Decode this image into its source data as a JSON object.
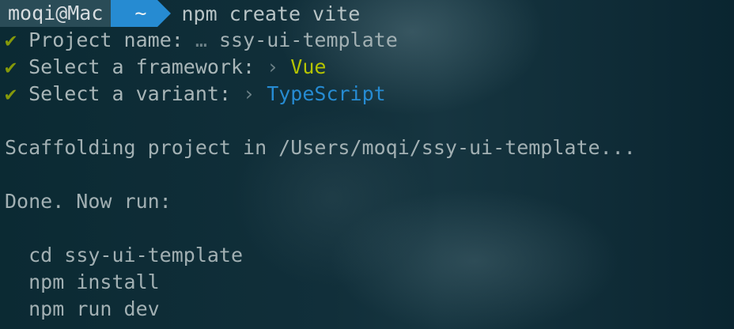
{
  "prompt": {
    "user_host": "moqi@Mac",
    "directory": "~",
    "command": "npm create vite"
  },
  "answers": [
    {
      "check": "✔",
      "label": "Project name:",
      "separator": "…",
      "value": "ssy-ui-template"
    },
    {
      "check": "✔",
      "label": "Select a framework:",
      "separator": "›",
      "value": "Vue"
    },
    {
      "check": "✔",
      "label": "Select a variant:",
      "separator": "›",
      "value": "TypeScript"
    }
  ],
  "output": {
    "scaffolding": "Scaffolding project in /Users/moqi/ssy-ui-template...",
    "done": "Done. Now run:",
    "next_steps": [
      "cd ssy-ui-template",
      "npm install",
      "npm run dev"
    ]
  },
  "colors": {
    "background": "#0c2a33",
    "check": "#85990a",
    "framework_value": "#b5c400",
    "variant_value": "#268bd2",
    "prompt_user_bg": "#2a4c57",
    "prompt_dir_bg": "#268bd2"
  }
}
